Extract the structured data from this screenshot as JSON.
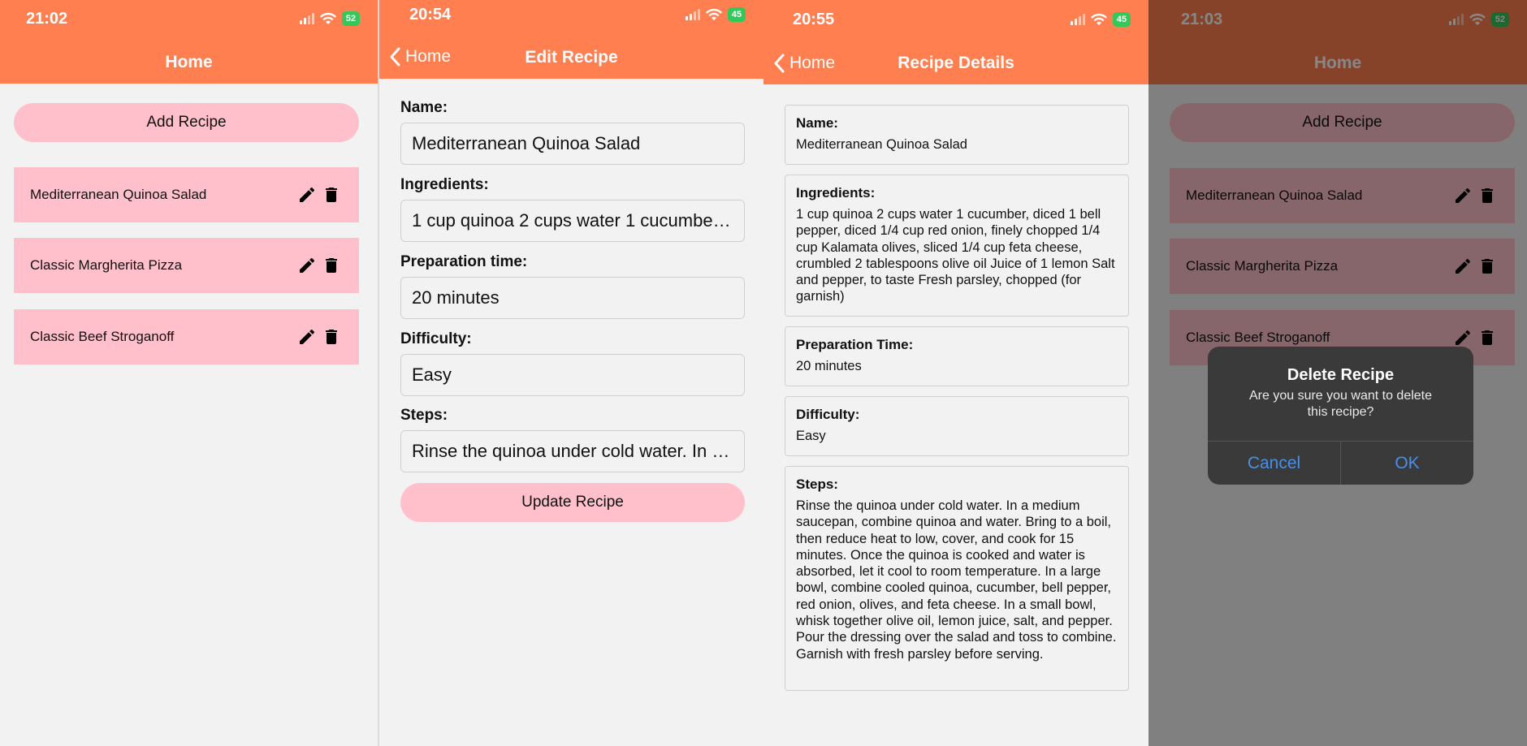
{
  "colors": {
    "header": "#ff7f50",
    "pill": "#ffc0cb",
    "battery": "#34c759",
    "dialog_button": "#4a8fe7"
  },
  "screen1": {
    "status": {
      "time": "21:02",
      "battery": "52"
    },
    "title": "Home",
    "add_button": "Add Recipe",
    "recipes": [
      {
        "name": "Mediterranean Quinoa Salad"
      },
      {
        "name": "Classic Margherita Pizza"
      },
      {
        "name": "Classic Beef Stroganoff"
      }
    ],
    "icons": {
      "edit": "pencil-icon",
      "delete": "trash-icon"
    }
  },
  "screen2": {
    "status": {
      "time": "20:54",
      "battery": "45"
    },
    "back_label": "Home",
    "title": "Edit Recipe",
    "fields": [
      {
        "label": "Name:",
        "value": "Mediterranean Quinoa Salad"
      },
      {
        "label": "Ingredients:",
        "value": "1 cup quinoa 2 cups water 1 cucumber,..."
      },
      {
        "label": "Preparation time:",
        "value": "20 minutes"
      },
      {
        "label": "Difficulty:",
        "value": "Easy"
      },
      {
        "label": "Steps:",
        "value": "Rinse the quinoa under cold water. In a..."
      }
    ],
    "update_button": "Update Recipe"
  },
  "screen3": {
    "status": {
      "time": "20:55",
      "battery": "45"
    },
    "back_label": "Home",
    "title": "Recipe Details",
    "details": [
      {
        "label": "Name:",
        "value": "Mediterranean Quinoa Salad"
      },
      {
        "label": "Ingredients:",
        "value": "1 cup quinoa 2 cups water 1 cucumber, diced 1 bell pepper, diced 1/4 cup red onion, finely chopped 1/4 cup Kalamata olives, sliced 1/4 cup feta cheese, crumbled 2 tablespoons olive oil Juice of 1 lemon Salt and pepper, to taste Fresh parsley, chopped (for garnish)"
      },
      {
        "label": "Preparation Time:",
        "value": "20 minutes"
      },
      {
        "label": "Difficulty:",
        "value": "Easy"
      },
      {
        "label": "Steps:",
        "value": "Rinse the quinoa under cold water. In a medium saucepan, combine quinoa and water. Bring to a boil, then reduce heat to low, cover, and cook for 15 minutes. Once the quinoa is cooked and water is absorbed, let it cool to room temperature. In a large bowl, combine cooled quinoa, cucumber, bell pepper, red onion, olives, and feta cheese. In a small bowl, whisk together olive oil, lemon juice, salt, and pepper. Pour the dressing over the salad and toss to combine. Garnish with fresh parsley before serving."
      }
    ]
  },
  "screen4": {
    "status": {
      "time": "21:03",
      "battery": "52"
    },
    "title": "Home",
    "add_button": "Add Recipe",
    "recipes": [
      {
        "name": "Mediterranean Quinoa Salad"
      },
      {
        "name": "Classic Margherita Pizza"
      },
      {
        "name": "Classic Beef Stroganoff"
      }
    ],
    "dialog": {
      "title": "Delete Recipe",
      "message": "Are you sure you want to delete this recipe?",
      "cancel": "Cancel",
      "ok": "OK"
    }
  }
}
